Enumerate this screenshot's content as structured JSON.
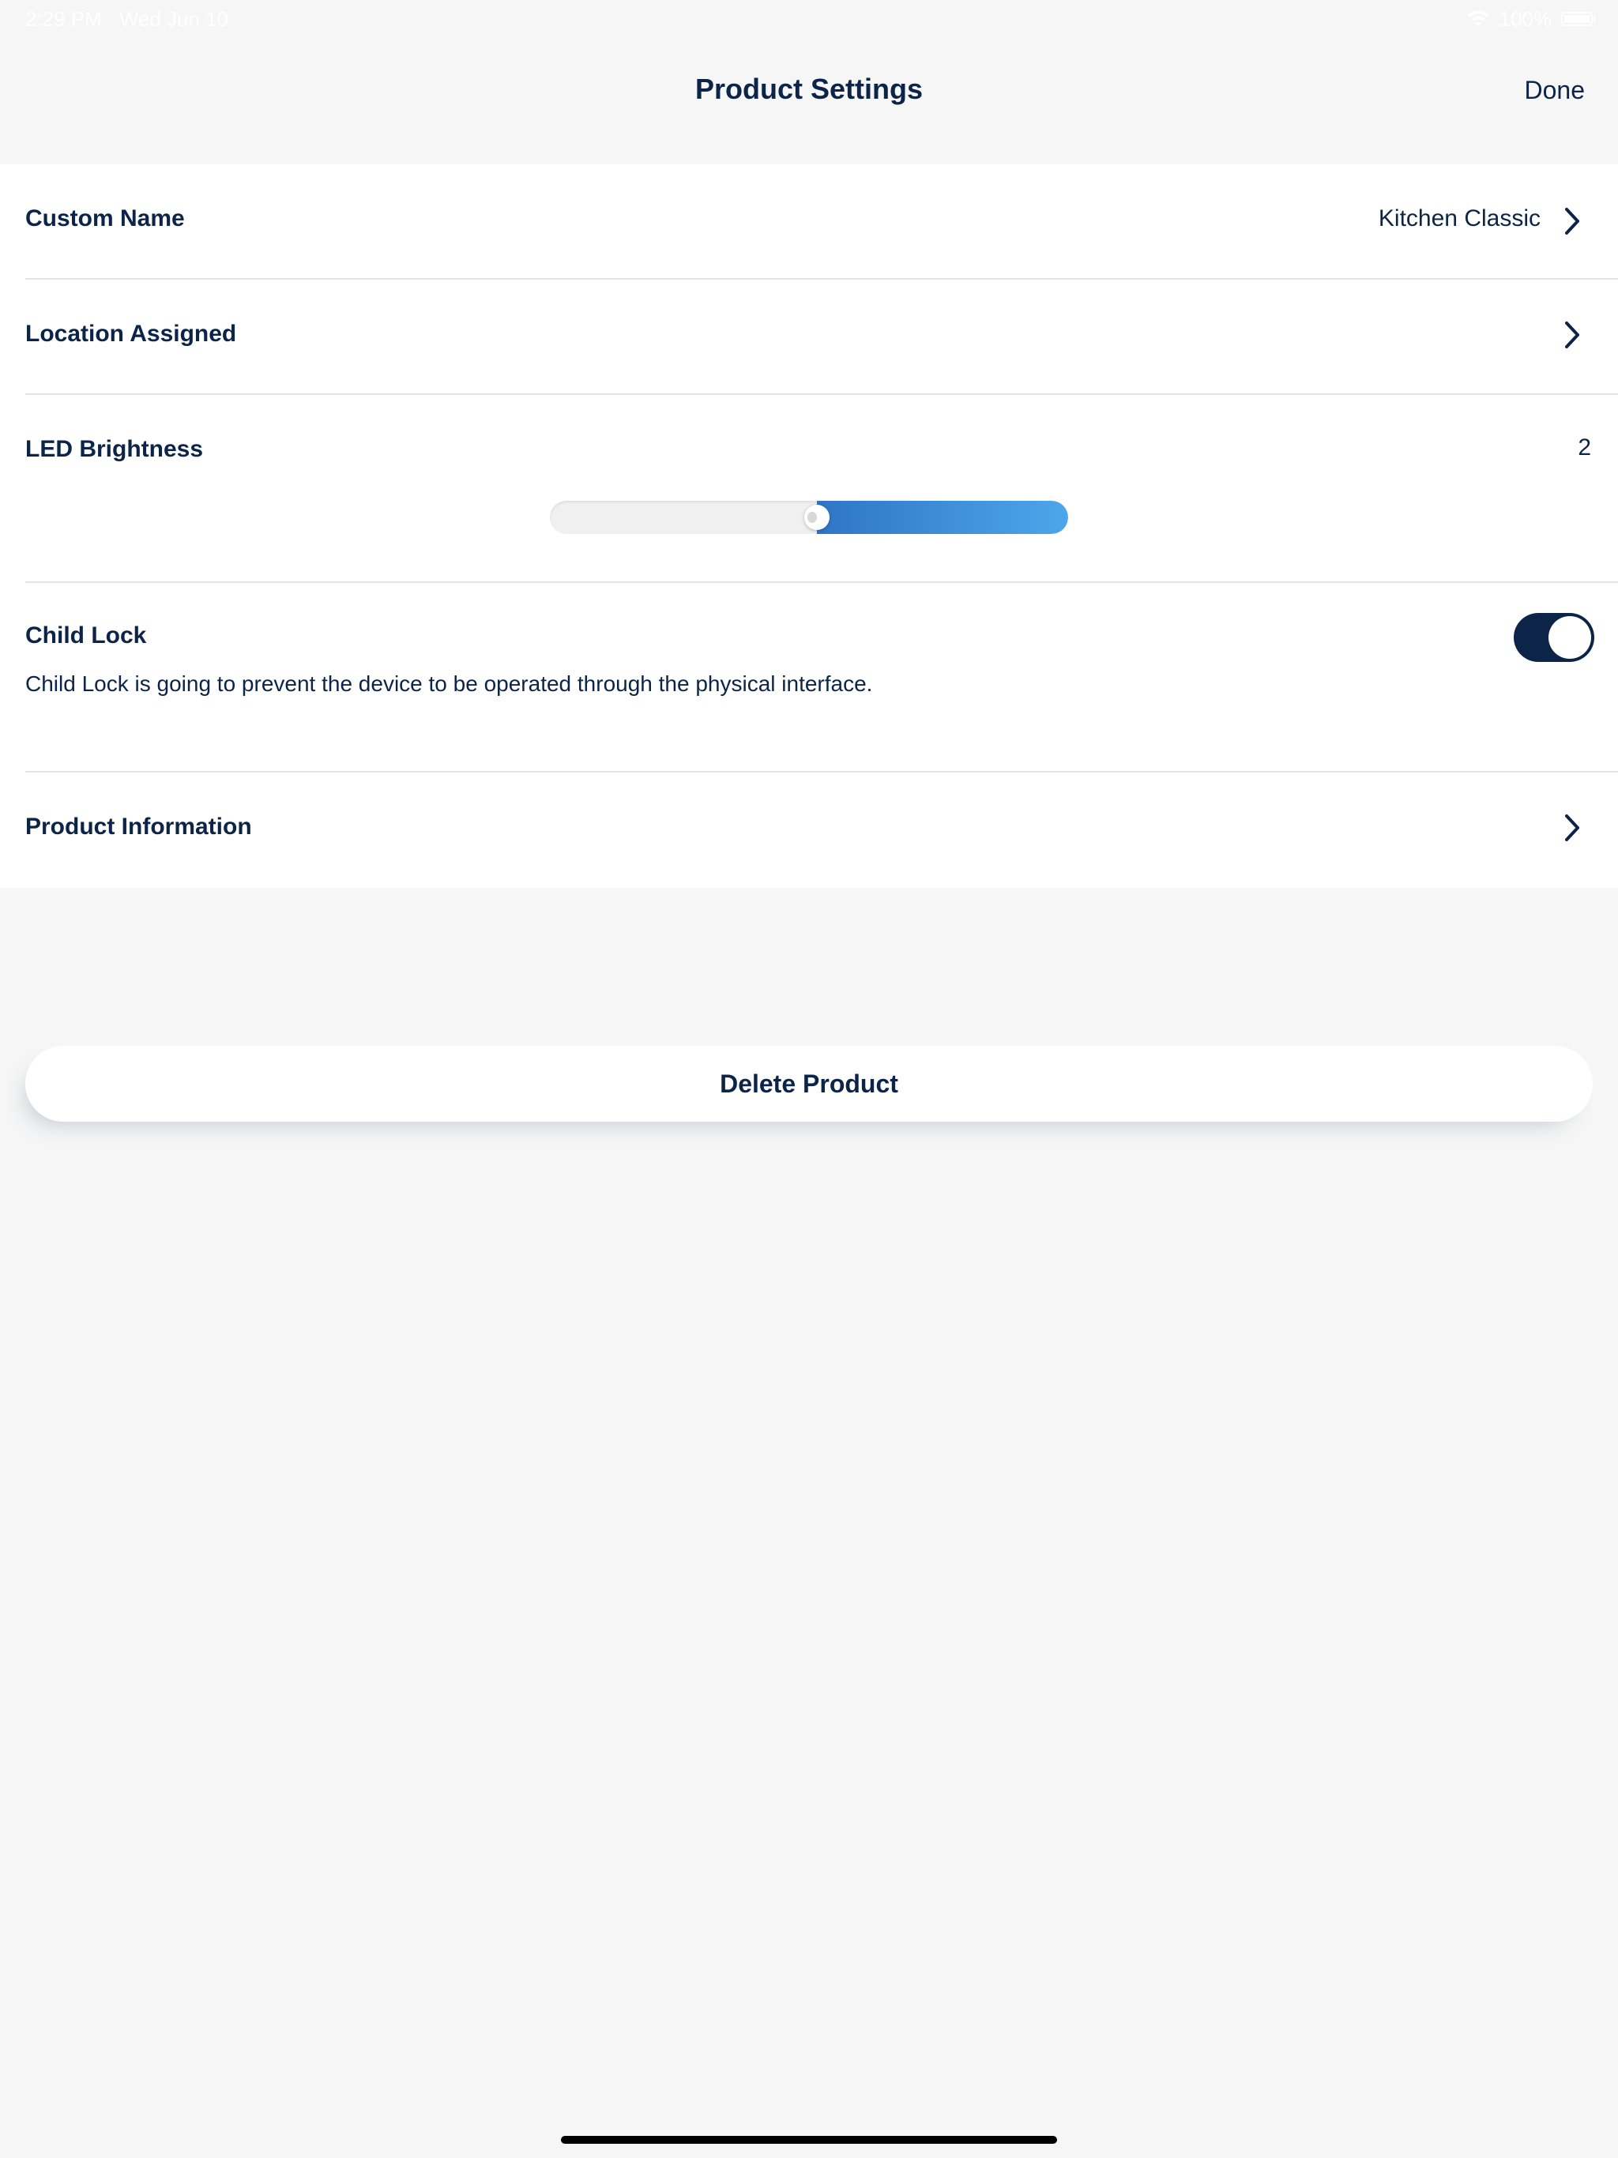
{
  "status_bar": {
    "time": "2:29 PM",
    "date": "Wed Jun 10",
    "battery": "100%"
  },
  "nav": {
    "title": "Product Settings",
    "done_label": "Done"
  },
  "settings": {
    "custom_name": {
      "label": "Custom Name",
      "value": "Kitchen Classic"
    },
    "location": {
      "label": "Location Assigned"
    },
    "led_brightness": {
      "label": "LED Brightness",
      "value": "2",
      "slider_fraction": 0.5
    },
    "child_lock": {
      "label": "Child Lock",
      "enabled": true,
      "description": "Child Lock is going to prevent the device to be operated through the physical interface."
    },
    "product_info": {
      "label": "Product Information"
    }
  },
  "delete_button": {
    "label": "Delete Product"
  },
  "colors": {
    "primary": "#0b2447",
    "slider_start": "#2f75c6",
    "slider_end": "#4da6ea",
    "background": "#f6f6f6",
    "card": "#ffffff"
  }
}
